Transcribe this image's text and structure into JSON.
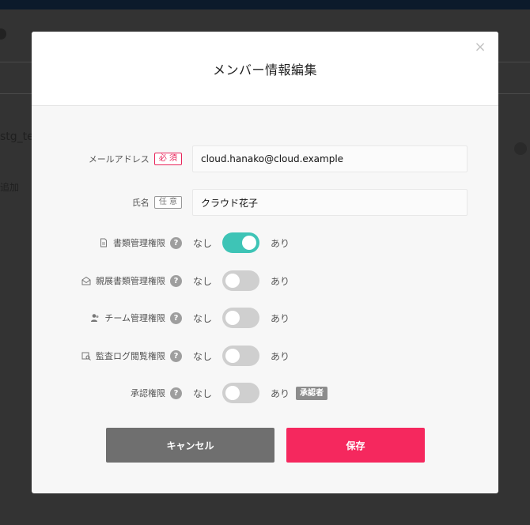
{
  "background": {
    "text_1": "stg_te",
    "text_2": "追加"
  },
  "modal": {
    "title": "メンバー情報編集",
    "close_glyph": "×"
  },
  "form": {
    "email": {
      "label": "メールアドレス",
      "badge": "必 須",
      "value": "cloud.hanako@cloud.example"
    },
    "name": {
      "label": "氏名",
      "badge": "任 意",
      "value": "クラウド花子"
    },
    "permissions": [
      {
        "label": "書類管理権限",
        "icon": "document-icon",
        "off_label": "なし",
        "on_label": "あり",
        "enabled": true
      },
      {
        "label": "親展書類管理権限",
        "icon": "confidential-envelope-icon",
        "off_label": "なし",
        "on_label": "あり",
        "enabled": false
      },
      {
        "label": "チーム管理権限",
        "icon": "team-icon",
        "off_label": "なし",
        "on_label": "あり",
        "enabled": false
      },
      {
        "label": "監査ログ閲覧権限",
        "icon": "audit-log-icon",
        "off_label": "なし",
        "on_label": "あり",
        "enabled": false
      },
      {
        "label": "承認権限",
        "icon": "",
        "off_label": "なし",
        "on_label": "あり",
        "enabled": false,
        "tag": "承認者"
      }
    ],
    "help_glyph": "?"
  },
  "buttons": {
    "cancel_label": "キャンセル",
    "save_label": "保存"
  },
  "colors": {
    "toggle_on": "#3ec4b6",
    "toggle_off": "#cfcfcf",
    "save": "#f5285e",
    "cancel": "#6f6f6f",
    "required": "#e8245a"
  }
}
